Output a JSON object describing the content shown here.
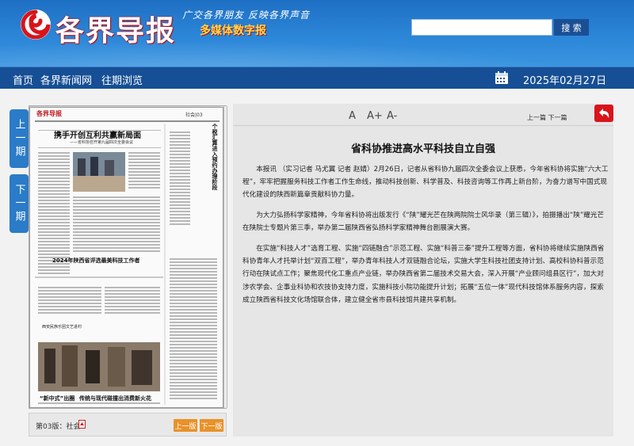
{
  "header": {
    "brand": "各界导报",
    "slogan": "广交各界朋友 反映各界声音",
    "subtitle": "多媒体数字报",
    "search_placeholder": "",
    "search_button": "搜 索"
  },
  "nav": {
    "items": [
      "首页",
      "各界新闻网",
      "往期浏览"
    ],
    "date": "2025年02月27日"
  },
  "sidebar": {
    "prev_issue": "上一期",
    "next_issue": "下一期"
  },
  "paper_thumb": {
    "masthead": "各界导报",
    "section_marker": "社会|03",
    "headline": "携手开创互利共赢新局面",
    "subheadline": "——省科协召开第九届四次全委会议",
    "mid_headline": "2024年陕西省评选最美科技工作者",
    "photo_caption": "西安民族乐团文艺进村",
    "bottom_headline_1": "“新中式”出圈",
    "bottom_headline_2": "传统与现代碰撞出消费新火花",
    "vertical_title": "个税汇算进入预约办理阶段"
  },
  "paper_footer": {
    "page_label": "第03版：社会",
    "prev_page": "上一版",
    "next_page": "下一版"
  },
  "toolbar": {
    "font_small": "A",
    "font_large": "A+",
    "font_reset": "A-",
    "prev_next": "上一篇 下一篇"
  },
  "article": {
    "title": "省科协推进高水平科技自立自强",
    "paragraphs": [
      "本报讯 （实习记者 马尤翼 记者 赵婧）2月26日，记者从省科协九届四次全委会议上获悉，今年省科协将实施“六大工程”，牢牢把握服务科技工作者工作生命线，推动科技创新、科学普及、科技咨询等工作再上新台阶，为奋力谱写中国式现代化建设的陕西新篇章贡献科协力量。",
      "为大力弘扬科学家精神，今年省科协将出版发行《“陕”耀光芒在陕两院院士风华录（第三辑）》，拍摄播出“陕”耀光芒在陕院士专题片第三季，举办第二届陕西省弘扬科学家精神舞台剧展演大赛。",
      "在实施“科技人才”选育工程、实施“四链融合”示范工程、实施“科普三秦”提升工程等方面，省科协将继续实施陕西省科协青年人才托举计划“双百工程”，举办青年科技人才双链融合论坛，实施大学生科技社团支持计划、高校科协科普示范行动在陕试点工作；聚焦现代化工重点产业链，举办陕西省第二届技术交易大会，深入开展“产业顾问组县区行”，加大对涉农学会、企事业科协和农技协支持力度，实施科技小院功能提升计划；拓展“五位一体”现代科技馆体系服务内容，探索成立陕西省科技文化场馆联合体，建立健全省市县科技馆共建共享机制。"
    ]
  },
  "colors": {
    "header_blue": "#2c86d8",
    "nav_blue": "#164f95",
    "accent_orange": "#e8922a",
    "subtitle_yellow": "#ffd84a"
  }
}
